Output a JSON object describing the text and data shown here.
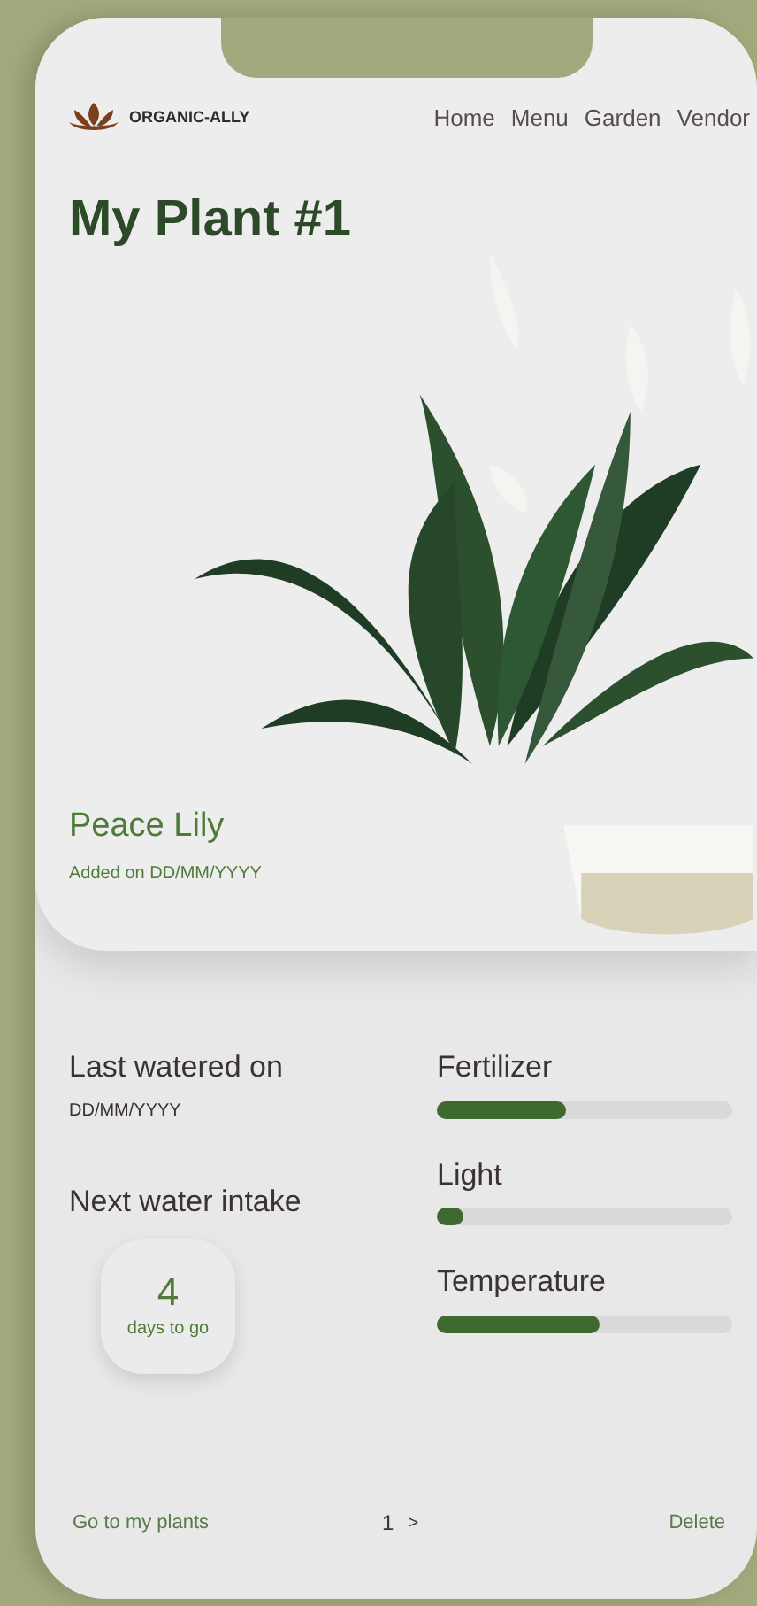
{
  "header": {
    "brand": "ORGANIC-ALLY",
    "nav": [
      "Home",
      "Menu",
      "Garden",
      "Vendor"
    ]
  },
  "title": "My Plant #1",
  "plant": {
    "name": "Peace Lily",
    "added": "Added on DD/MM/YYYY"
  },
  "watering": {
    "last_label": "Last watered on",
    "last_date": "DD/MM/YYYY",
    "next_label": "Next water intake",
    "days": "4",
    "days_caption": "days to go"
  },
  "meters": [
    {
      "label": "Fertilizer",
      "level": 0.44
    },
    {
      "label": "Light",
      "level": 0.09
    },
    {
      "label": "Temperature",
      "level": 0.55
    }
  ],
  "footer": {
    "link": "Go to my plants",
    "page": "1",
    "next": ">",
    "delete": "Delete"
  }
}
